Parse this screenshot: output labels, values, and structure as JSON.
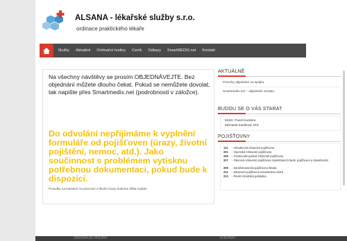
{
  "header": {
    "title": "ALSANA - lékařské služby s.r.o.",
    "subtitle": "ordinace praktického lékaře"
  },
  "nav": {
    "home_icon": "home-icon",
    "items": [
      {
        "label": "Služby"
      },
      {
        "label": "Aktuálně"
      },
      {
        "label": "Ordinační hodiny"
      },
      {
        "label": "Ceník"
      },
      {
        "label": "Odkazy"
      },
      {
        "label": "SmartMEDIX.net"
      },
      {
        "label": "Kontakt"
      }
    ]
  },
  "main": {
    "notice": "Na všechny návštěvy se prosím OBJEDNÁVEJTE. Bez objednání můžete dlouho čekat. Pokud se nemůžete dovolat, tak napište přes Smartmedix.net (podrobnosti v záložce).",
    "highlight": "Do odvolání nepřijímáme k vyplnění formuláře od pojišťoven (úrazy, životní pojištění, nemoc, atd.). Jako součinnost s problémem vytisknu potřebnou dokumentaci, pokud bude k dispozici.",
    "small_note": "Posudky na bolestné za pracovní a školní úrazy budeme dělat nadále."
  },
  "sidebar": {
    "news": {
      "title": "AKTUÁLNĚ",
      "links": [
        "Poruchy objednání na spojku",
        "Smartmedix.net – objednání receptu"
      ]
    },
    "staff": {
      "title": "BUDOU SE O VÁS STARAT",
      "lines": [
        "MUDr. Pavel Kazdera",
        "Michaela Kasíková, DiS."
      ]
    },
    "insurance": {
      "title": "POJIŠŤOVNY",
      "items": [
        {
          "code": "111",
          "name": "Všeobecná zdravotní pojišťovna"
        },
        {
          "code": "201",
          "name": "Vojenská zdravotní pojišťovna"
        },
        {
          "code": "205",
          "name": "Česká průmyslová zdravotní pojišťovna"
        },
        {
          "code": "207",
          "name": "Oborová zdravotní pojišťovna zaměstnanců bank, pojišťoven a stavebnictví"
        },
        {
          "code": "209",
          "name": "Zaměstnanecká pojišťovna Škoda"
        },
        {
          "code": "211",
          "name": "Zdravotní pojišťovna ministerstva vnitra"
        },
        {
          "code": "213",
          "name": "Revírní bratrská pokladna"
        }
      ]
    }
  },
  "footer": {
    "left": "ORDINAČNÍ HODINY",
    "right": "KONTAKT"
  },
  "colors": {
    "accent_red": "#d63b2f",
    "nav_bg": "#4a4a4a",
    "highlight_yellow": "#f3c10a",
    "logo_blue": "#5fa8d8"
  }
}
